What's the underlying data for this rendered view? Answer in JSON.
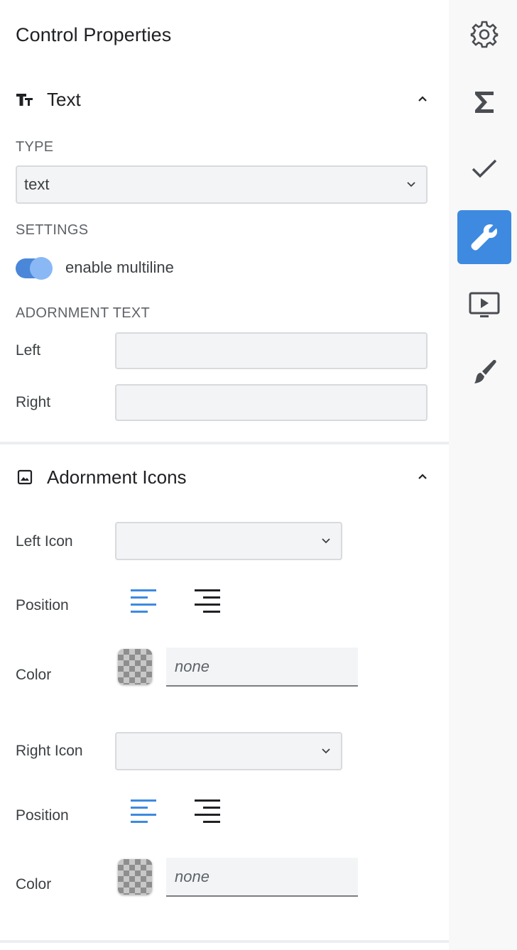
{
  "panel": {
    "title": "Control Properties"
  },
  "text_section": {
    "title": "Text",
    "icon": "text-size-icon",
    "expanded": true,
    "type_heading": "TYPE",
    "type_value": "text",
    "settings_heading": "SETTINGS",
    "multiline_label": "enable multiline",
    "multiline_enabled": true,
    "adornment_heading": "ADORNMENT TEXT",
    "left_label": "Left",
    "left_value": "",
    "right_label": "Right",
    "right_value": ""
  },
  "icons_section": {
    "title": "Adornment Icons",
    "icon": "image-icon",
    "expanded": true,
    "left_icon_label": "Left Icon",
    "left_icon_value": "",
    "left_position_label": "Position",
    "left_color_label": "Color",
    "left_color_value": "none",
    "right_icon_label": "Right Icon",
    "right_icon_value": "",
    "right_position_label": "Position",
    "right_color_label": "Color",
    "right_color_value": "none"
  },
  "rail": {
    "items": [
      {
        "icon": "gear-icon",
        "active": false
      },
      {
        "icon": "sigma-icon",
        "active": false
      },
      {
        "icon": "check-icon",
        "active": false
      },
      {
        "icon": "wrench-icon",
        "active": true
      },
      {
        "icon": "slideshow-icon",
        "active": false
      },
      {
        "icon": "brush-icon",
        "active": false
      }
    ]
  },
  "colors": {
    "accent": "#3d8ae0",
    "toggle_track": "#4a87d8",
    "toggle_knob": "#8ab8f5",
    "align_left_active": "#3d8ae0",
    "align_right": "#202124"
  }
}
